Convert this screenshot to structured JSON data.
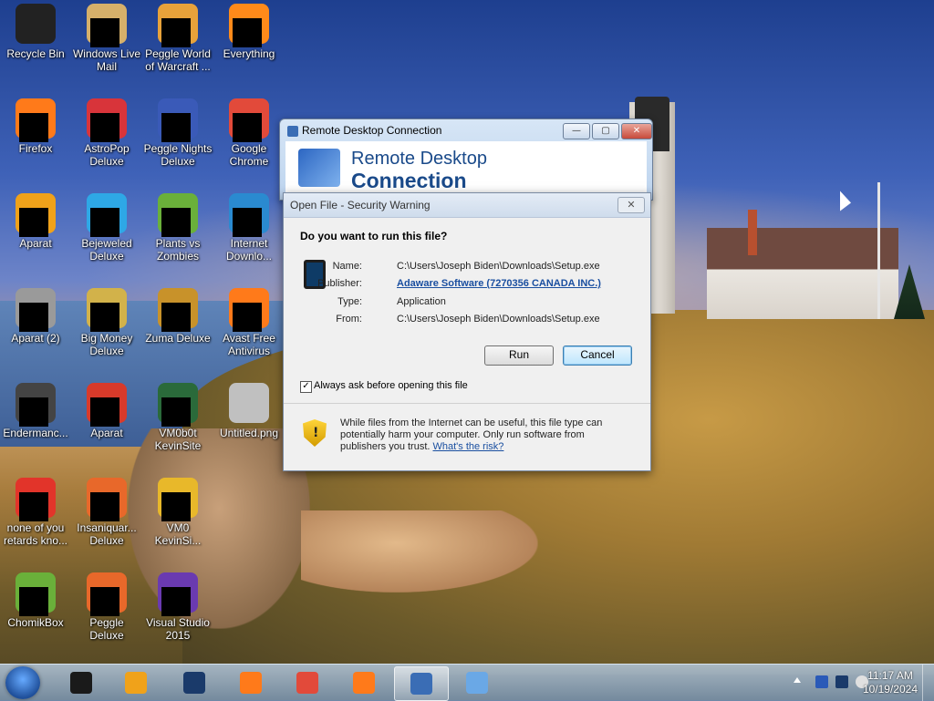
{
  "desktop": {
    "icons": [
      {
        "label": "Recycle Bin",
        "icon": "recycle-bin-icon",
        "color": "#222222"
      },
      {
        "label": "Windows Live Mail",
        "icon": "mail-icon",
        "color": "#d6b06a"
      },
      {
        "label": "Peggle World of Warcraft ...",
        "icon": "peggle-icon",
        "color": "#e8a23a"
      },
      {
        "label": "Everything",
        "icon": "everything-icon",
        "color": "#ff8a1a"
      },
      {
        "label": "Firefox",
        "icon": "firefox-icon",
        "color": "#ff7a1a"
      },
      {
        "label": "AstroPop Deluxe",
        "icon": "astropop-icon",
        "color": "#d8343a"
      },
      {
        "label": "Peggle Nights Deluxe",
        "icon": "peggle-nights-icon",
        "color": "#3a5ab8"
      },
      {
        "label": "Google Chrome",
        "icon": "chrome-icon",
        "color": "#e24a3a"
      },
      {
        "label": "Aparat",
        "icon": "aparat-icon",
        "color": "#f0a21a"
      },
      {
        "label": "Bejeweled Deluxe",
        "icon": "bejeweled-icon",
        "color": "#2ea8e6"
      },
      {
        "label": "Plants vs Zombies",
        "icon": "pvz-icon",
        "color": "#6ab03a"
      },
      {
        "label": "Internet Downlo...",
        "icon": "idm-icon",
        "color": "#2a8ad0"
      },
      {
        "label": "Aparat (2)",
        "icon": "aparat-2-icon",
        "color": "#9a9a9a"
      },
      {
        "label": "Big Money Deluxe",
        "icon": "big-money-icon",
        "color": "#d2b24a"
      },
      {
        "label": "Zuma Deluxe",
        "icon": "zuma-icon",
        "color": "#c8922a"
      },
      {
        "label": "Avast Free Antivirus",
        "icon": "avast-icon",
        "color": "#ff7a1a"
      },
      {
        "label": "Endermanc...",
        "icon": "endermanch-icon",
        "color": "#444444"
      },
      {
        "label": "Aparat",
        "icon": "aparat-3-icon",
        "color": "#d83a2a"
      },
      {
        "label": "VM0b0t KevinSite",
        "icon": "vm-icon",
        "color": "#2a6a3a"
      },
      {
        "label": "Untitled.png",
        "icon": "image-file-icon",
        "color": "#c0c0c0"
      },
      {
        "label": "none of you retards kno...",
        "icon": "opera-icon",
        "color": "#e2342a"
      },
      {
        "label": "Insaniquar... Deluxe",
        "icon": "insaniquarium-icon",
        "color": "#e8682a"
      },
      {
        "label": "VM0 KevinSi...",
        "icon": "chrome-2-icon",
        "color": "#e8b82a"
      },
      {
        "label": "ChomikBox",
        "icon": "chomikbox-icon",
        "color": "#6ab03a"
      },
      {
        "label": "Peggle Deluxe",
        "icon": "peggle-deluxe-icon",
        "color": "#e8682a"
      },
      {
        "label": "Visual Studio 2015",
        "icon": "visual-studio-icon",
        "color": "#6a3ab0"
      }
    ]
  },
  "rdc_window": {
    "title": "Remote Desktop Connection",
    "heading_line1": "Remote Desktop",
    "heading_line2": "Connection",
    "min_label": "—",
    "max_label": "▢",
    "close_label": "✕"
  },
  "security_dialog": {
    "title": "Open File - Security Warning",
    "close_label": "✕",
    "question": "Do you want to run this file?",
    "fields": [
      {
        "label": "Name:",
        "value": "C:\\Users\\Joseph Biden\\Downloads\\Setup.exe",
        "link": false
      },
      {
        "label": "Publisher:",
        "value": "Adaware Software (7270356 CANADA INC.)",
        "link": true
      },
      {
        "label": "Type:",
        "value": "Application",
        "link": false
      },
      {
        "label": "From:",
        "value": "C:\\Users\\Joseph Biden\\Downloads\\Setup.exe",
        "link": false
      }
    ],
    "run_label": "Run",
    "cancel_label": "Cancel",
    "checkbox_label": "Always ask before opening this file",
    "checkbox_checked": true,
    "warning_text": "While files from the Internet can be useful, this file type can potentially harm your computer. Only run software from publishers you trust.",
    "warning_link": "What's the risk?"
  },
  "taskbar": {
    "items": [
      {
        "name": "explorer-icon",
        "color": "#1a1a1a",
        "active": false
      },
      {
        "name": "media-player-icon",
        "color": "#f0a21a",
        "active": false
      },
      {
        "name": "globe-icon",
        "color": "#1a3a6a",
        "active": false
      },
      {
        "name": "firefox-icon",
        "color": "#ff7a1a",
        "active": false
      },
      {
        "name": "chrome-icon",
        "color": "#e24a3a",
        "active": false
      },
      {
        "name": "avast-icon",
        "color": "#ff7a1a",
        "active": false
      },
      {
        "name": "remote-desktop-icon",
        "color": "#3a6db5",
        "active": true
      },
      {
        "name": "paint-icon",
        "color": "#6aa8e6",
        "active": false
      }
    ],
    "clock_time": "11:17 AM",
    "clock_date": "10/19/2024"
  }
}
